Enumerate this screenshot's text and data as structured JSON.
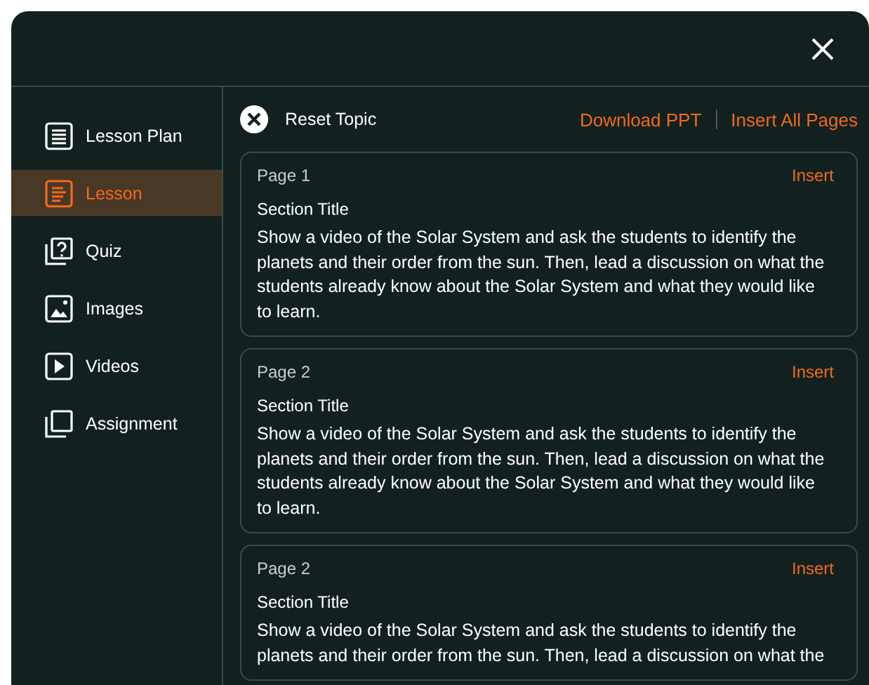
{
  "sidebar": {
    "items": [
      {
        "label": "Lesson Plan",
        "kind": "plan",
        "selected": false
      },
      {
        "label": "Lesson",
        "kind": "lesson",
        "selected": true
      },
      {
        "label": "Quiz",
        "kind": "quiz",
        "selected": false
      },
      {
        "label": "Images",
        "kind": "images",
        "selected": false
      },
      {
        "label": "Videos",
        "kind": "videos",
        "selected": false
      },
      {
        "label": "Assignment",
        "kind": "assignment",
        "selected": false
      }
    ]
  },
  "toolbar": {
    "reset": "Reset Topic",
    "download": "Download PPT",
    "insert_all": "Insert All Pages"
  },
  "pages": [
    {
      "page": "Page 1",
      "insert": "Insert",
      "section_title": "Section Title",
      "body": "Show a video of the Solar System and ask the students to identify the planets and their order from the sun. Then, lead a discussion on what the students already know about the Solar System and what they would like to learn."
    },
    {
      "page": "Page 2",
      "insert": "Insert",
      "section_title": "Section Title",
      "body": "Show a video of the Solar System and ask the students to identify the planets and their order from the sun. Then, lead a discussion on what the students already know about the Solar System and what they would like to learn."
    },
    {
      "page": "Page 2",
      "insert": "Insert",
      "section_title": "Section Title",
      "body": "Show a video of the Solar System and ask the students to identify the planets and their order from the sun. Then, lead a discussion on what the"
    }
  ]
}
